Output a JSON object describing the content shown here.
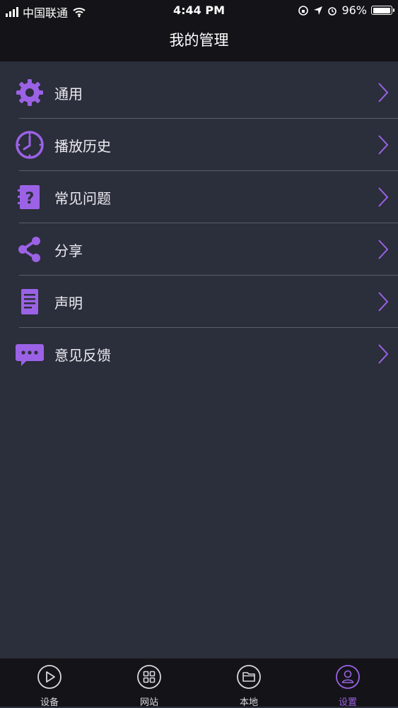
{
  "status": {
    "carrier": "中国联通",
    "time": "4:44 PM",
    "battery": "96%",
    "battery_level": 0.96
  },
  "header": {
    "title": "我的管理"
  },
  "menu": {
    "items": [
      {
        "label": "通用",
        "icon": "gear-icon"
      },
      {
        "label": "播放历史",
        "icon": "clock-icon"
      },
      {
        "label": "常见问题",
        "icon": "question-book-icon"
      },
      {
        "label": "分享",
        "icon": "share-icon"
      },
      {
        "label": "声明",
        "icon": "document-icon"
      },
      {
        "label": "意见反馈",
        "icon": "chat-bubble-icon"
      }
    ]
  },
  "tabs": [
    {
      "label": "设备",
      "icon": "play-circle-icon"
    },
    {
      "label": "网站",
      "icon": "grid-icon"
    },
    {
      "label": "本地",
      "icon": "folder-icon"
    },
    {
      "label": "设置",
      "icon": "user-icon",
      "active": true
    }
  ],
  "colors": {
    "accent": "#9b62e6",
    "background": "#2b2e3b",
    "bar": "#141418"
  }
}
